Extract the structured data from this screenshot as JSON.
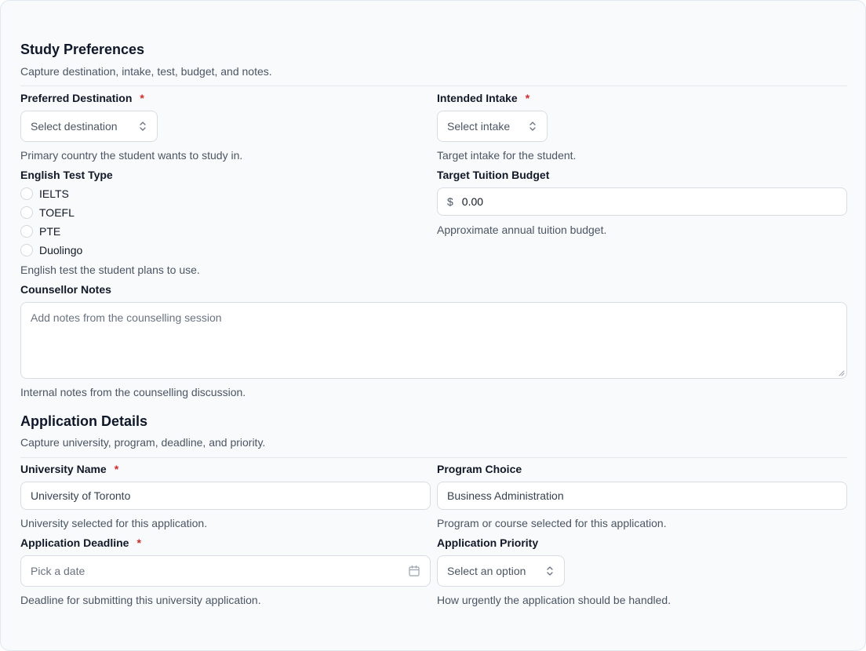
{
  "study": {
    "title": "Study Preferences",
    "description": "Capture destination, intake, test, budget, and notes.",
    "destination": {
      "label": "Preferred Destination",
      "required": "*",
      "placeholder": "Select destination",
      "help": "Primary country the student wants to study in."
    },
    "intake": {
      "label": "Intended Intake",
      "required": "*",
      "placeholder": "Select intake",
      "help": "Target intake for the student."
    },
    "english_test": {
      "label": "English Test Type",
      "options": [
        "IELTS",
        "TOEFL",
        "PTE",
        "Duolingo"
      ],
      "help": "English test the student plans to use."
    },
    "budget": {
      "label": "Target Tuition Budget",
      "currency": "$",
      "value": "0.00",
      "help": "Approximate annual tuition budget."
    },
    "notes": {
      "label": "Counsellor Notes",
      "placeholder": "Add notes from the counselling session",
      "help": "Internal notes from the counselling discussion."
    }
  },
  "application": {
    "title": "Application Details",
    "description": "Capture university, program, deadline, and priority.",
    "university": {
      "label": "University Name",
      "required": "*",
      "value": "University of Toronto",
      "help": "University selected for this application."
    },
    "program": {
      "label": "Program Choice",
      "value": "Business Administration",
      "help": "Program or course selected for this application."
    },
    "deadline": {
      "label": "Application Deadline",
      "required": "*",
      "placeholder": "Pick a date",
      "help": "Deadline for submitting this university application."
    },
    "priority": {
      "label": "Application Priority",
      "placeholder": "Select an option",
      "help": "How urgently the application should be handled."
    }
  },
  "icons": {
    "select": "chevron-up-down-icon",
    "date": "calendar-icon"
  },
  "colors": {
    "required": "#dc2626",
    "background": "#f8fafc",
    "border": "#d9dde3"
  }
}
